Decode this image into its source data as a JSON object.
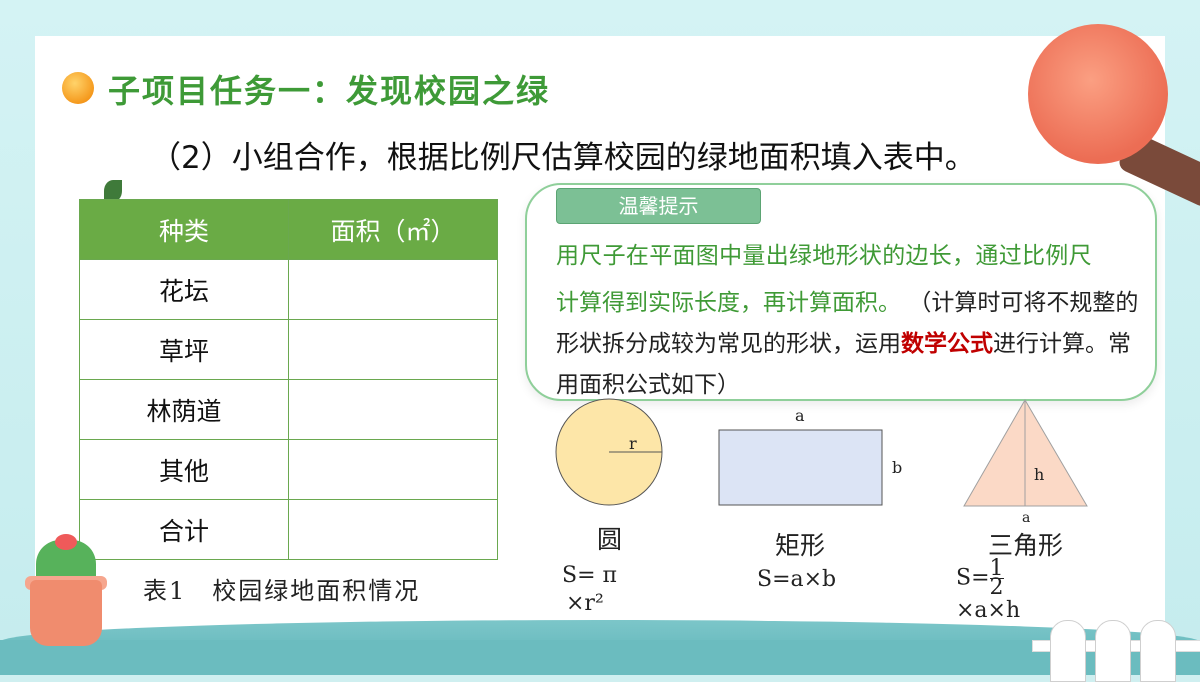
{
  "heading": "子项目任务一：发现校园之绿",
  "subtitle": "（2）小组合作，根据比例尺估算校园的绿地面积填入表中。",
  "table": {
    "headers": [
      "种类",
      "面积（㎡）"
    ],
    "rows": [
      {
        "kind": "花坛",
        "area": ""
      },
      {
        "kind": "草坪",
        "area": ""
      },
      {
        "kind": "林荫道",
        "area": ""
      },
      {
        "kind": "其他",
        "area": ""
      },
      {
        "kind": "合计",
        "area": ""
      }
    ],
    "caption": "表1　校园绿地面积情况"
  },
  "tip": {
    "label": "温馨提示",
    "line1": "用尺子在平面图中量出绿地形状的边长，通过比例尺",
    "line2a": "计算得到实际长度，再计算面积。",
    "line2b": "（计算时可将不规整的形状拆分成较为常见的形状，运用",
    "highlight": "数学公式",
    "line2c": "进行计算。常用面积公式如下）"
  },
  "shapes": {
    "circle": {
      "radius_label": "r",
      "name": "圆",
      "formula_1": "S= π",
      "formula_2": "×r²"
    },
    "rectangle": {
      "top_label": "a",
      "side_label": "b",
      "name": "矩形",
      "formula": "S=a×b"
    },
    "triangle": {
      "height_label": "h",
      "base_label": "a",
      "name": "三角形",
      "formula_1": "S=",
      "fraction_num": "1",
      "fraction_den": "2",
      "formula_2": "×a×h"
    }
  },
  "colors": {
    "heading": "#3e9a37",
    "table_header": "#6aab45",
    "tip_label": "#7cc095",
    "highlight": "#c00000"
  }
}
